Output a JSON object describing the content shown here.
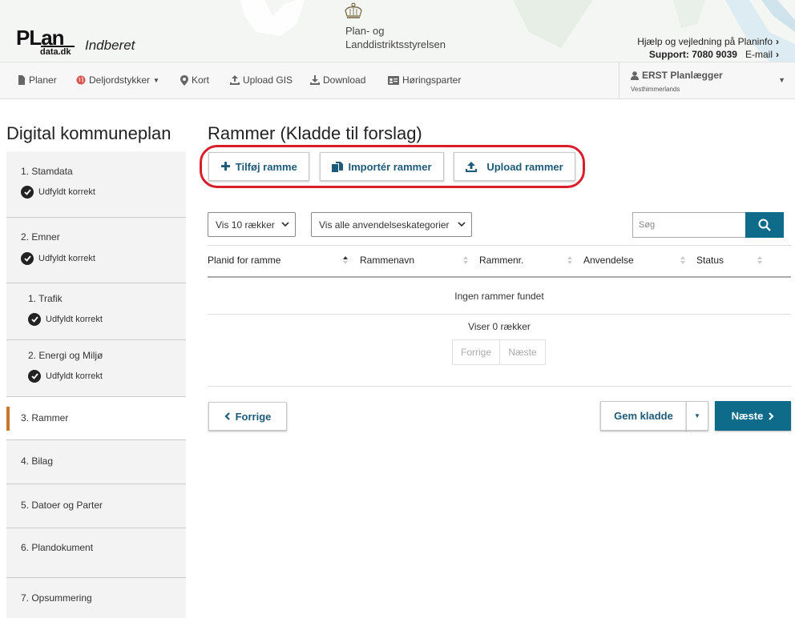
{
  "header": {
    "logo_text": "PLan",
    "logo_sub": "data.dk",
    "app_name": "Indberet",
    "agency_line1": "Plan- og",
    "agency_line2": "Landdistriktsstyrelsen",
    "help_link": "Hjælp og vejledning på Planinfo",
    "support_label": "Support: 7080 9039",
    "email_link": "E-mail"
  },
  "nav": {
    "items": [
      {
        "label": "Planer",
        "icon": "document-icon"
      },
      {
        "label": "Deljordstykker",
        "icon": "globe-icon"
      },
      {
        "label": "Kort",
        "icon": "map-marker-icon"
      },
      {
        "label": "Upload GIS",
        "icon": "upload-icon"
      },
      {
        "label": "Download",
        "icon": "download-icon"
      },
      {
        "label": "Høringsparter",
        "icon": "id-card-icon"
      }
    ],
    "user_name": "ERST Planlægger",
    "user_org": "Vesthimmerlands"
  },
  "sidebar": {
    "title": "Digital kommuneplan",
    "steps": [
      {
        "label": "1. Stamdata",
        "status": "Udfyldt korrekt"
      },
      {
        "label": "2. Emner",
        "status": "Udfyldt korrekt"
      },
      {
        "label": "1. Trafik",
        "status": "Udfyldt korrekt"
      },
      {
        "label": "2. Energi og Miljø",
        "status": "Udfyldt korrekt"
      },
      {
        "label": "3. Rammer",
        "status": ""
      },
      {
        "label": "4. Bilag",
        "status": ""
      },
      {
        "label": "5. Datoer og Parter",
        "status": ""
      },
      {
        "label": "6. Plandokument",
        "status": ""
      },
      {
        "label": "7. Opsummering",
        "status": ""
      }
    ]
  },
  "main": {
    "title": "Rammer (Kladde til forslag)",
    "actions": {
      "add": "Tilføj ramme",
      "import": "Importér rammer",
      "upload": "Upload rammer"
    },
    "filters": {
      "rows": "Vis 10 rækker",
      "category": "Vis alle anvendelseskategorier",
      "search_placeholder": "Søg"
    },
    "table": {
      "columns": [
        "Planid for ramme",
        "Rammenavn",
        "Rammenr.",
        "Anvendelse",
        "Status"
      ],
      "empty": "Ingen rammer fundet",
      "info": "Viser 0 rækker"
    },
    "pager": {
      "prev": "Forrige",
      "next": "Næste"
    },
    "footer": {
      "back": "Forrige",
      "save": "Gem kladde",
      "next": "Næste"
    }
  },
  "colors": {
    "accent": "#0f6b8a",
    "link": "#1e5a78",
    "highlight": "#d81e2a",
    "active_marker": "#c8782a"
  }
}
